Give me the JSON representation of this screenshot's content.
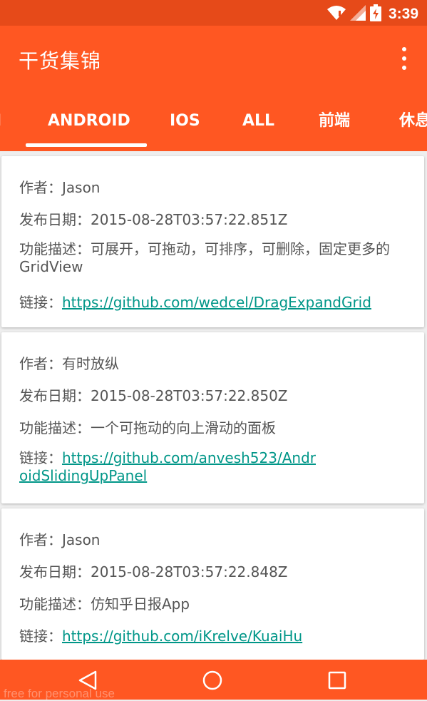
{
  "status_bar": {
    "time": "3:39"
  },
  "app_bar": {
    "title": "干货集锦"
  },
  "tabs": [
    {
      "label": "ANDROID",
      "selected": true
    },
    {
      "label": "IOS"
    },
    {
      "label": "ALL"
    },
    {
      "label": "前端"
    },
    {
      "label": "休息"
    }
  ],
  "labels": {
    "author": "作者：",
    "date": "发布日期：",
    "desc": "功能描述：",
    "link": "链接："
  },
  "cards": [
    {
      "author": "Jason",
      "date": "2015-08-28T03:57:22.851Z",
      "desc": "可展开，可拖动，可排序，可删除，固定更多的GridView",
      "url": "https://github.com/wedcel/DragExpandGrid"
    },
    {
      "author": "有时放纵",
      "date": "2015-08-28T03:57:22.850Z",
      "desc": "一个可拖动的向上滑动的面板",
      "url": "https://github.com/anvesh523/AndroidSlidingUpPanel"
    },
    {
      "author": "Jason",
      "date": "2015-08-28T03:57:22.848Z",
      "desc": "仿知乎日报App",
      "url": "https://github.com/iKrelve/KuaiHu"
    }
  ],
  "watermark": "free for personal use",
  "colors": {
    "primary": "#ff5722",
    "primary_dark": "#e64a19",
    "link": "#009688"
  }
}
